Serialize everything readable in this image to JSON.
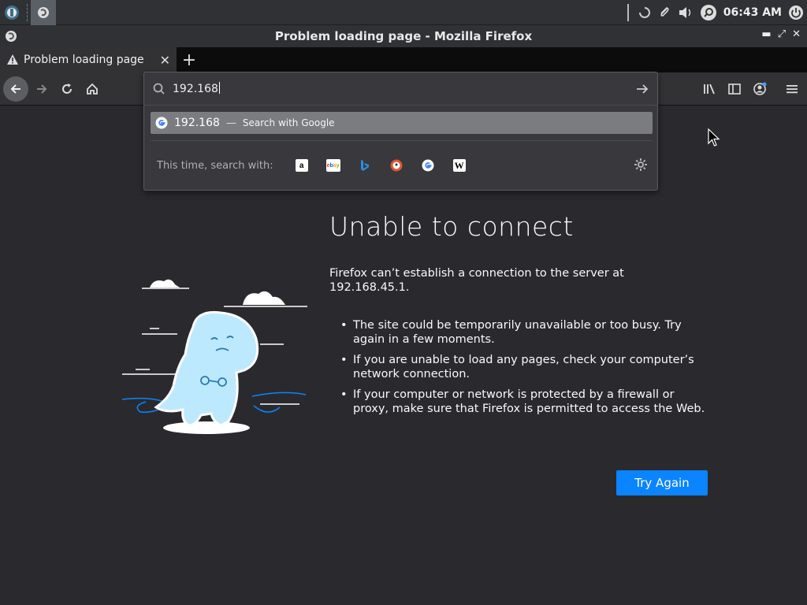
{
  "taskbar": {
    "clock": "06:43 AM"
  },
  "window": {
    "title": "Problem loading page - Mozilla Firefox"
  },
  "tab": {
    "title": "Problem loading page"
  },
  "urlbar": {
    "value": "192.168",
    "suggestion": {
      "query": "192.168",
      "separator": "—",
      "action": "Search with Google"
    },
    "oneoff_label": "This time, search with:",
    "engines": [
      "amazon-icon",
      "ebay-icon",
      "bing-icon",
      "duckduckgo-icon",
      "google-icon",
      "wikipedia-icon"
    ]
  },
  "error": {
    "title": "Unable to connect",
    "description": "Firefox can’t establish a connection to the server at 192.168.45.1.",
    "bullets": [
      "The site could be temporarily unavailable or too busy. Try again in a few moments.",
      "If you are unable to load any pages, check your computer’s network connection.",
      "If your computer or network is protected by a firewall or proxy, make sure that Firefox is permitted to access the Web."
    ],
    "button": "Try Again"
  },
  "colors": {
    "accent": "#0a84ff",
    "background": "#2a2a2e",
    "illustration": "#bde9ff"
  }
}
